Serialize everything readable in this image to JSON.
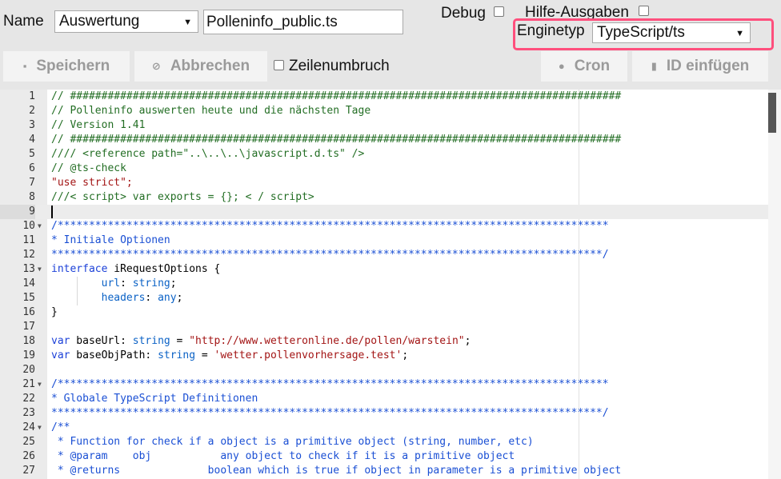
{
  "toolbar": {
    "name_label": "Name",
    "name_select_value": "Auswertung",
    "file_input_value": "Polleninfo_public.ts",
    "debug_label": "Debug",
    "hilfe_label": "Hilfe-Ausgaben",
    "engine_label": "Enginetyp",
    "engine_select_value": "TypeScript/ts",
    "save_label": "Speichern",
    "cancel_label": "Abbrechen",
    "wrap_label": "Zeilenumbruch",
    "cron_label": "Cron",
    "insert_id_label": "ID einfügen"
  },
  "colors": {
    "highlight_border": "#ff4f7d",
    "comment": "#236e24",
    "doc_comment": "#1a4fd4"
  },
  "editor": {
    "active_line": 9,
    "line_numbers": [
      "1",
      "2",
      "3",
      "4",
      "5",
      "6",
      "7",
      "8",
      "9",
      "10",
      "11",
      "12",
      "13",
      "14",
      "15",
      "16",
      "17",
      "18",
      "19",
      "20",
      "21",
      "22",
      "23",
      "24",
      "25",
      "26",
      "27"
    ],
    "folded_lines": [
      10,
      13,
      21,
      24
    ],
    "lines": {
      "l1": "// ########################################################################################",
      "l2": "// Polleninfo auswerten heute und die nächsten Tage",
      "l3": "// Version 1.41",
      "l4": "// ########################################################################################",
      "l5": "//// <reference path=\"..\\..\\..\\javascript.d.ts\" />",
      "l6": "// @ts-check",
      "l7": "\"use strict\";",
      "l8": "///< script> var exports = {}; < / script>",
      "l9": "",
      "l10": "/****************************************************************************************",
      "l11": "* Initiale Optionen",
      "l12": "****************************************************************************************/",
      "l13_kw": "interface",
      "l13_rest": " iRequestOptions {",
      "l14_name": "url",
      "l14_type": "string",
      "l15_name": "headers",
      "l15_type": "any",
      "l16": "}",
      "l17": "",
      "l18_kw": "var",
      "l18_name": " baseUrl",
      "l18_type": "string",
      "l18_str": "\"http://www.wetteronline.de/pollen/warstein\"",
      "l19_kw": "var",
      "l19_name": " baseObjPath",
      "l19_type": "string",
      "l19_str": "'wetter.pollenvorhersage.test'",
      "l20": "",
      "l21": "/****************************************************************************************",
      "l22": "* Globale TypeScript Definitionen",
      "l23": "****************************************************************************************/",
      "l24": "/**",
      "l25": " * Function for check if a object is a primitive object (string, number, etc)",
      "l26_tag": " * @param",
      "l26_rest": "    obj           any object to check if it is a primitive object",
      "l27_tag": " * @returns",
      "l27_rest": "              boolean which is true if object in parameter is a primitive object"
    }
  }
}
